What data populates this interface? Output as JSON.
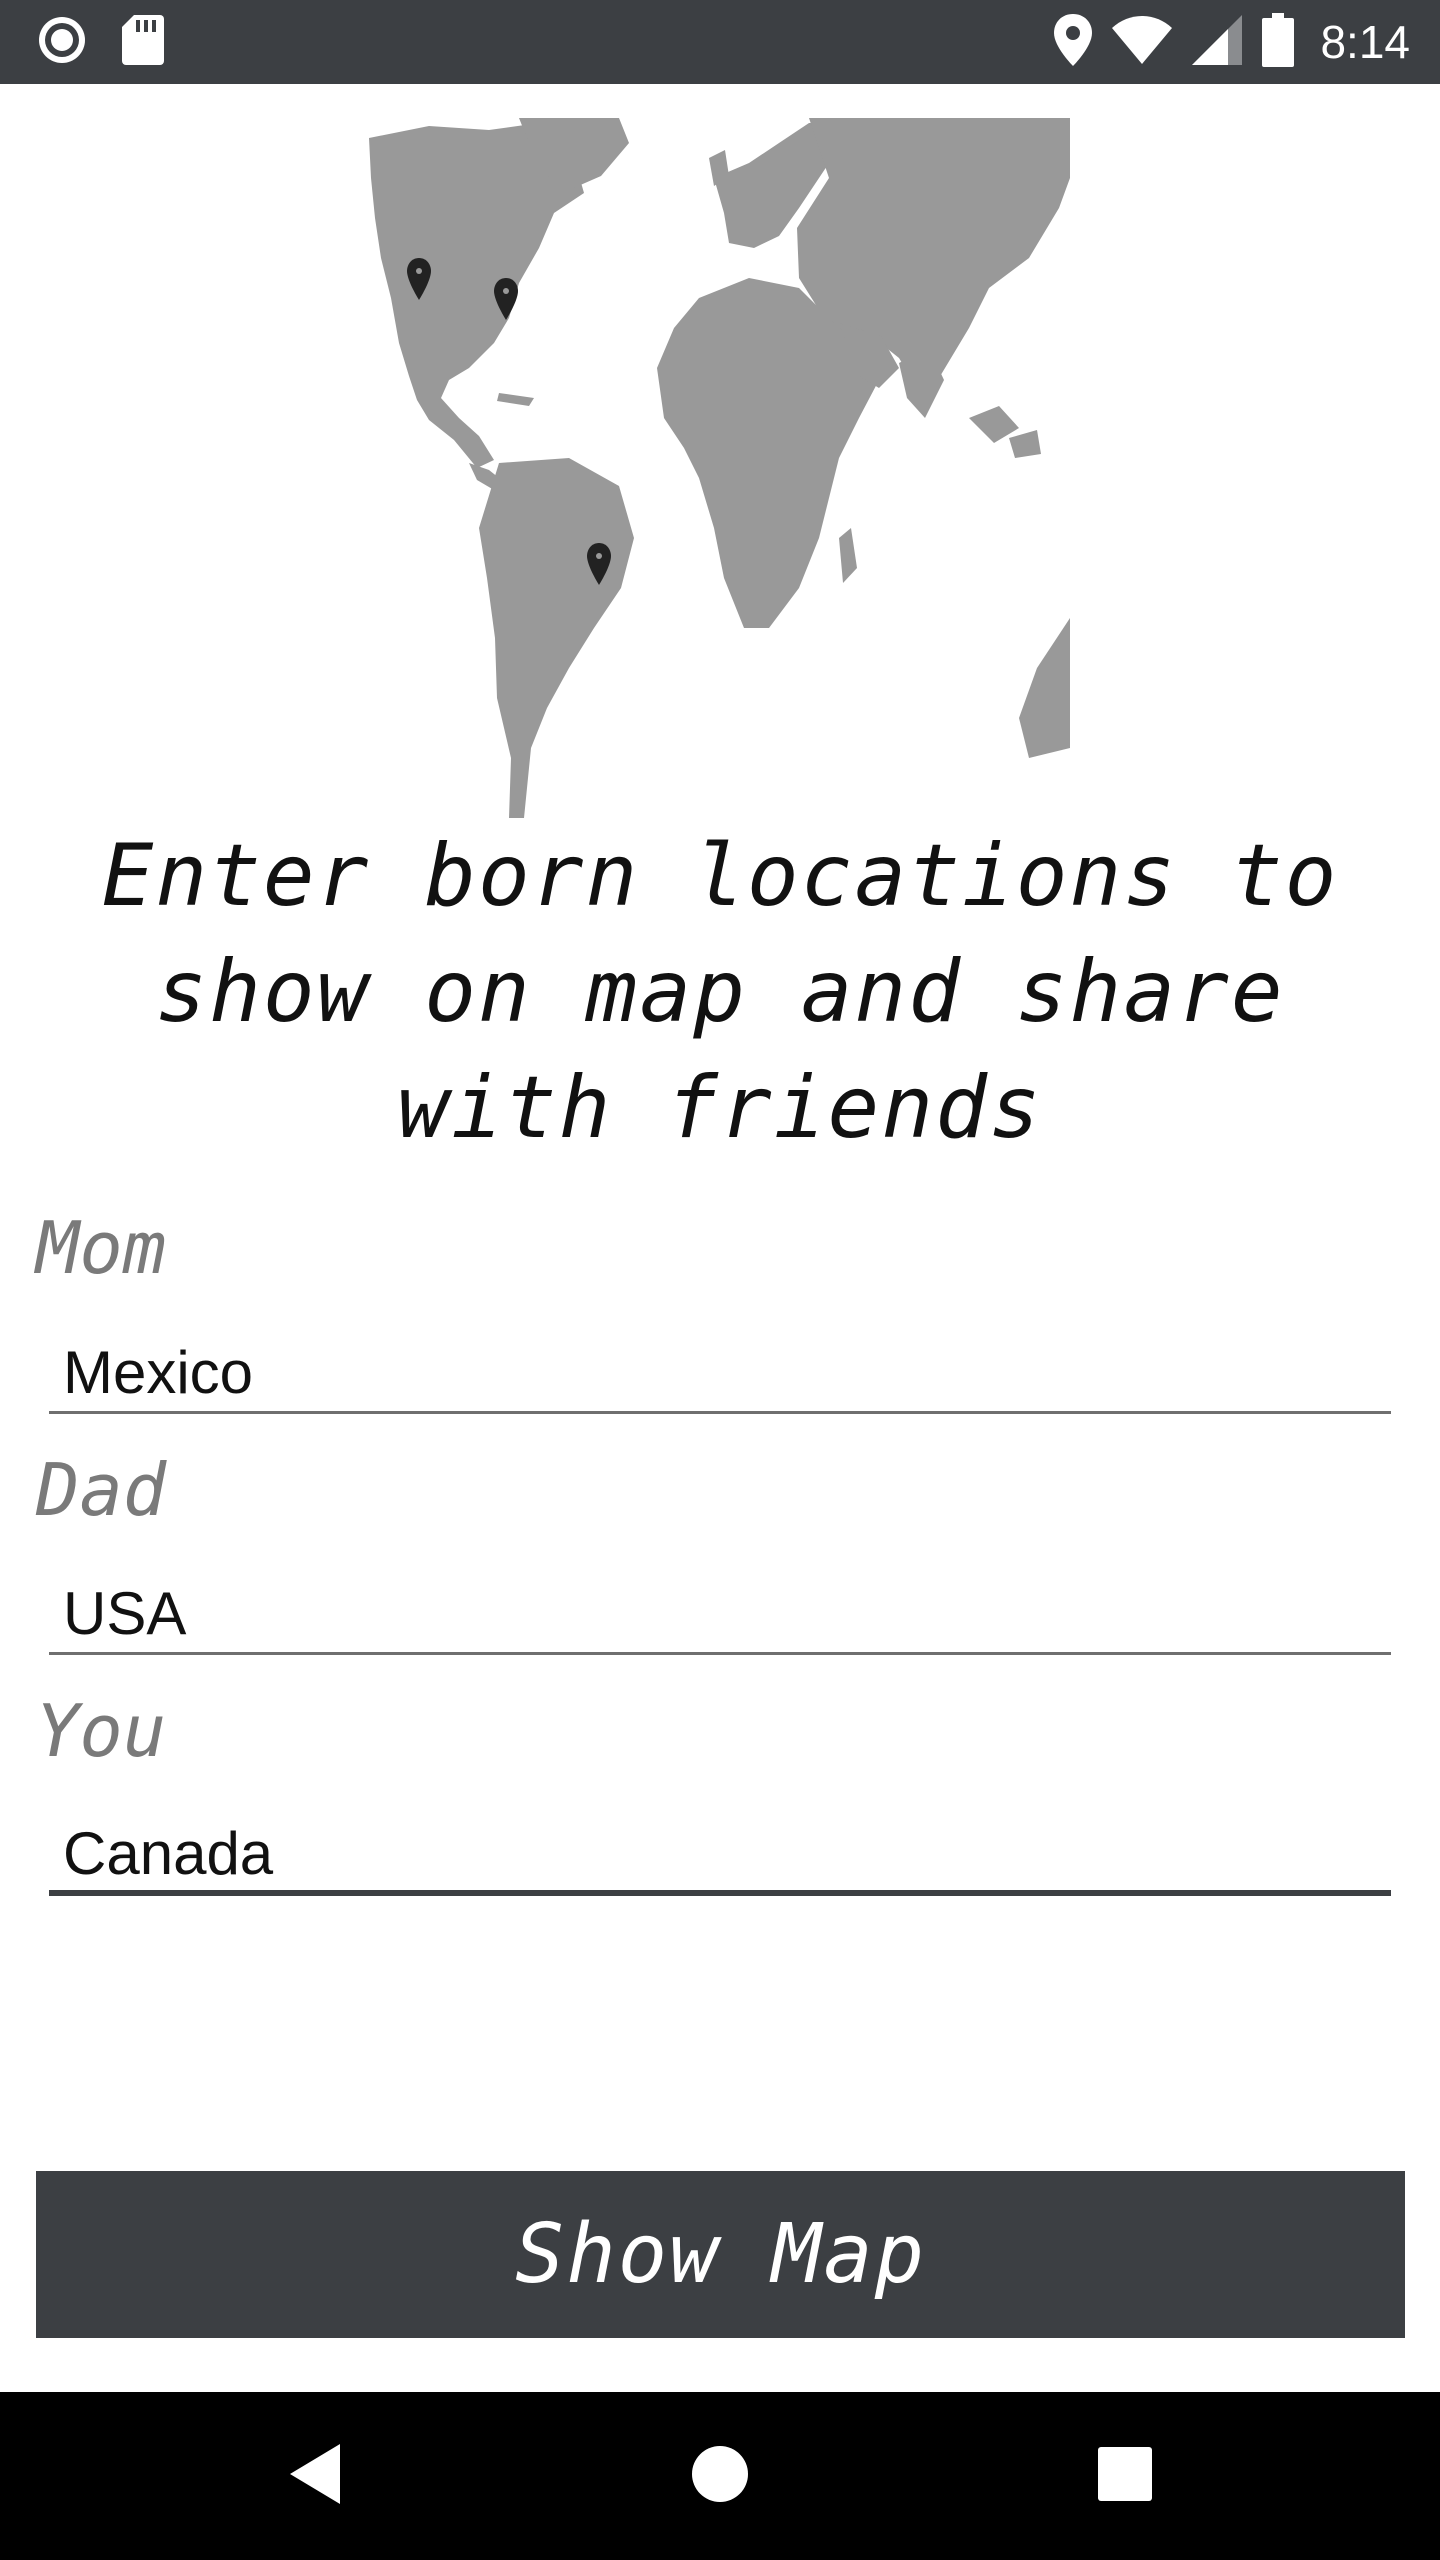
{
  "status_bar": {
    "time": "8:14",
    "left_icons": [
      "record-icon",
      "sd-card-icon"
    ],
    "right_icons": [
      "location-icon",
      "wifi-icon",
      "cell-signal-icon",
      "battery-icon"
    ]
  },
  "map": {
    "icon": "world-map-image",
    "pins": 3,
    "land_color": "#999999",
    "pin_color": "#222222"
  },
  "headline": "Enter born locations to show on map and share with friends",
  "fields": [
    {
      "label": "Mom",
      "value": "Mexico"
    },
    {
      "label": "Dad",
      "value": "USA"
    },
    {
      "label": "You",
      "value": "Canada"
    }
  ],
  "show_map_button": {
    "label": "Show Map"
  },
  "nav_bar": {
    "icons": [
      "back-icon",
      "home-icon",
      "recents-icon"
    ]
  },
  "colors": {
    "accent": "#3c3f43",
    "label": "#7a7a7a",
    "text": "#111111"
  }
}
